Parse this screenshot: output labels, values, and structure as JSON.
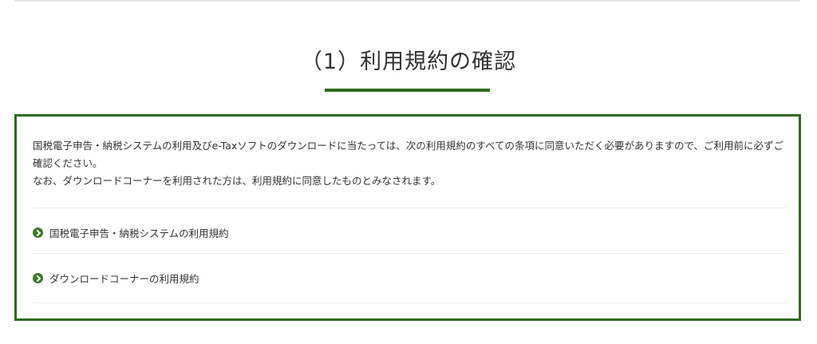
{
  "page_title": "（1）利用規約の確認",
  "terms_box": {
    "intro_line_1": "国税電子申告・納税システムの利用及びe-Taxソフトのダウンロードに当たっては、次の利用規約のすべての条項に同意いただく必要がありますので、ご利用前に必ずご確認ください。",
    "intro_line_2": "なお、ダウンロードコーナーを利用された方は、利用規約に同意したものとみなされます。",
    "links": [
      {
        "label": "国税電子申告・納税システムの利用規約",
        "icon": "chevron-right-circle-icon"
      },
      {
        "label": "ダウンロードコーナーの利用規約",
        "icon": "chevron-right-circle-icon"
      }
    ]
  },
  "colors": {
    "accent_green": "#2f6a1f",
    "text": "#333333"
  }
}
